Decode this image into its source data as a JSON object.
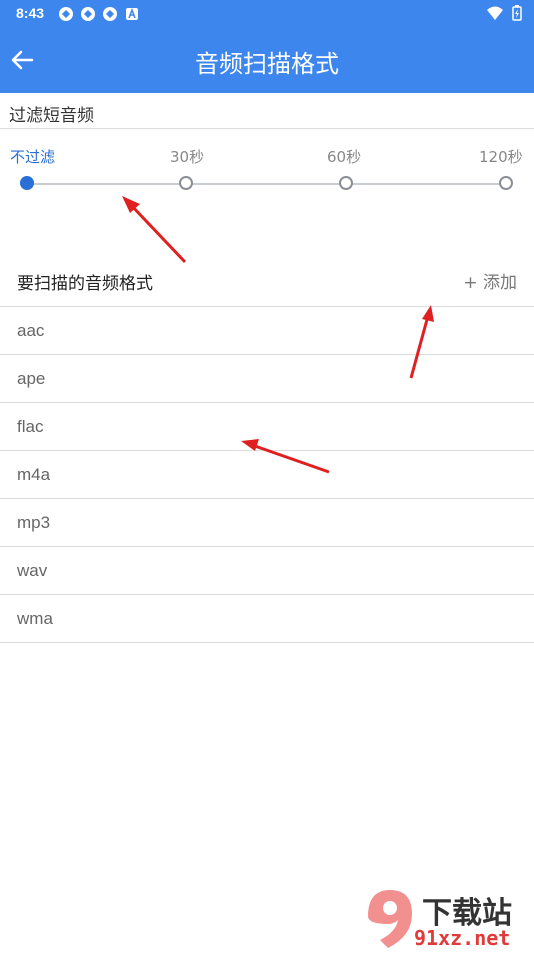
{
  "status": {
    "time": "8:43"
  },
  "header": {
    "title": "音频扫描格式"
  },
  "filter": {
    "label": "过滤短音频",
    "options": [
      "不过滤",
      "30秒",
      "60秒",
      "120秒"
    ],
    "selected_index": 0
  },
  "formats": {
    "label": "要扫描的音频格式",
    "add_label": "+ 添加",
    "items": [
      "aac",
      "ape",
      "flac",
      "m4a",
      "mp3",
      "wav",
      "wma"
    ]
  },
  "watermark": {
    "text_cn": "下载站",
    "text_url": "91xz.net"
  },
  "colors": {
    "primary": "#3d86ee",
    "selected": "#2a6fd6",
    "annotation": "#e02020"
  }
}
